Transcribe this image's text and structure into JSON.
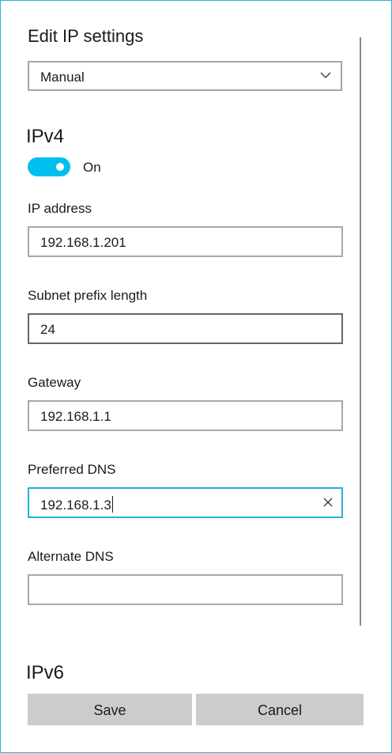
{
  "dialog": {
    "title": "Edit IP settings",
    "mode_select": {
      "value": "Manual",
      "icon": "chevron-down-icon"
    }
  },
  "ipv4": {
    "heading": "IPv4",
    "toggle": {
      "state": "on",
      "label": "On",
      "color": "#00bfef"
    },
    "ip_address": {
      "label": "IP address",
      "value": "192.168.1.201"
    },
    "subnet_prefix_length": {
      "label": "Subnet prefix length",
      "value": "24"
    },
    "gateway": {
      "label": "Gateway",
      "value": "192.168.1.1"
    },
    "preferred_dns": {
      "label": "Preferred DNS",
      "value": "192.168.1.3",
      "focused": true,
      "clear_icon": "close-icon"
    },
    "alternate_dns": {
      "label": "Alternate DNS",
      "value": ""
    }
  },
  "ipv6": {
    "heading": "IPv6"
  },
  "actions": {
    "save_label": "Save",
    "cancel_label": "Cancel"
  },
  "colors": {
    "accent": "#00bfef",
    "focus_border": "#1fb5dc",
    "button_bg": "#cccccc"
  }
}
